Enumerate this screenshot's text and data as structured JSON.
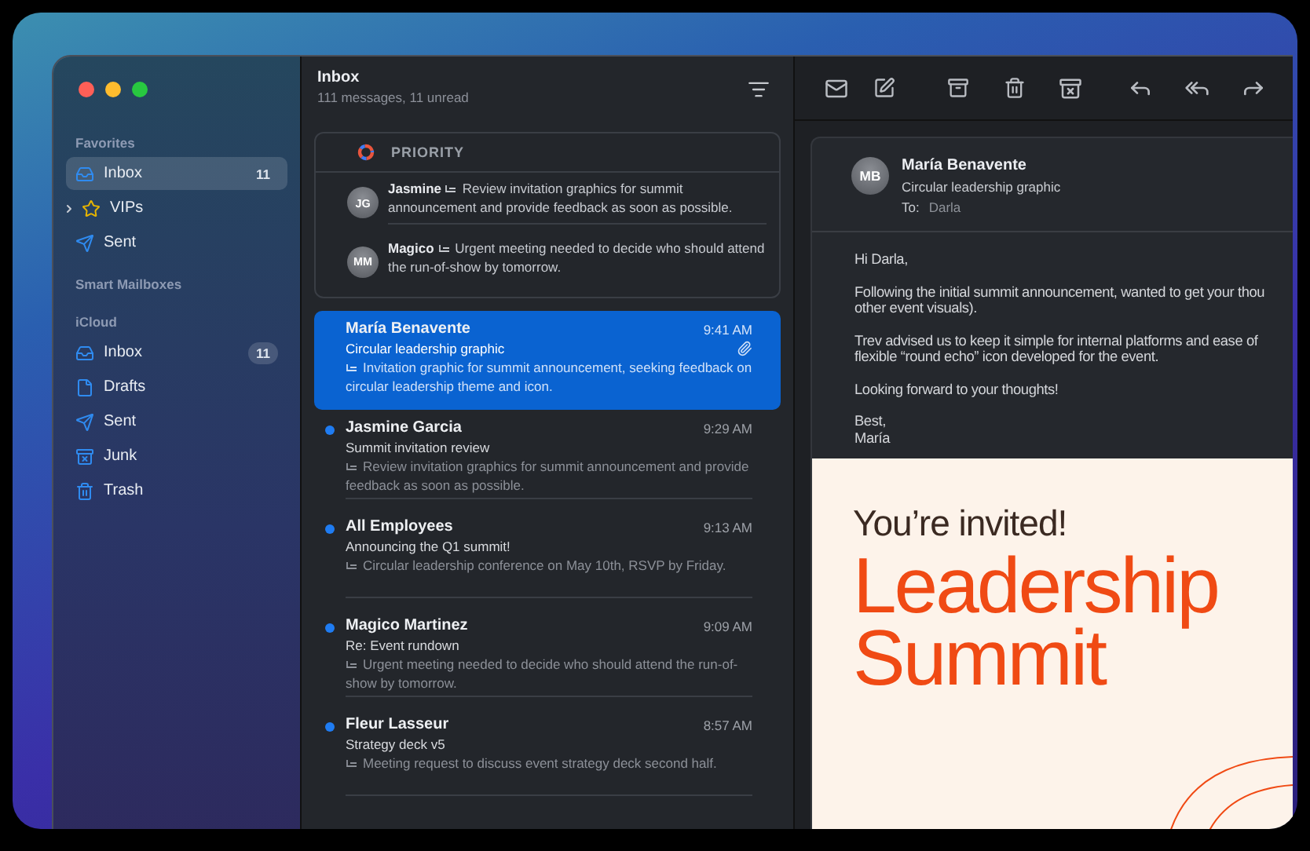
{
  "sidebar": {
    "sections": [
      {
        "title": "Favorites",
        "items": [
          {
            "label": "Inbox",
            "kind": "inbox",
            "count": "11",
            "selected": true,
            "expandable": false
          },
          {
            "label": "VIPs",
            "kind": "star",
            "selected": false,
            "expandable": true
          },
          {
            "label": "Sent",
            "kind": "sent",
            "selected": false,
            "expandable": false
          }
        ]
      },
      {
        "title": "Smart Mailboxes"
      },
      {
        "title": "iCloud",
        "items": [
          {
            "label": "Inbox",
            "kind": "inbox",
            "count": "11",
            "selected": false,
            "expandable": false
          },
          {
            "label": "Drafts",
            "kind": "drafts",
            "selected": false,
            "expandable": false
          },
          {
            "label": "Sent",
            "kind": "sent",
            "selected": false,
            "expandable": false
          },
          {
            "label": "Junk",
            "kind": "junk",
            "selected": false,
            "expandable": false
          },
          {
            "label": "Trash",
            "kind": "trash",
            "selected": false,
            "expandable": false
          }
        ]
      }
    ]
  },
  "message_list": {
    "title": "Inbox",
    "subtitle": "111 messages, 11 unread",
    "priority": {
      "label": "PRIORITY",
      "items": [
        {
          "initials": "JG",
          "sender": "Jasmine",
          "text": "Review invitation graphics for summit announcement and provide feedback as soon as possible."
        },
        {
          "initials": "MM",
          "sender": "Magico",
          "text": "Urgent meeting needed to decide who should attend the run-of-show by tomorrow."
        }
      ]
    },
    "messages": [
      {
        "sender": "María Benavente",
        "time": "9:41 AM",
        "subject": "Circular leadership graphic",
        "preview": "Invitation graphic for summit announcement, seeking feedback on circular leadership theme and icon.",
        "unread": false,
        "selected": true,
        "attachment": true
      },
      {
        "sender": "Jasmine Garcia",
        "time": "9:29 AM",
        "subject": "Summit invitation review",
        "preview": "Review invitation graphics for summit announcement and provide feedback as soon as possible.",
        "unread": true,
        "selected": false,
        "attachment": false
      },
      {
        "sender": "All Employees",
        "time": "9:13 AM",
        "subject": "Announcing the Q1 summit!",
        "preview": "Circular leadership conference on May 10th, RSVP by Friday.",
        "unread": true,
        "selected": false,
        "attachment": false
      },
      {
        "sender": "Magico Martinez",
        "time": "9:09 AM",
        "subject": "Re: Event rundown",
        "preview": "Urgent meeting needed to decide who should attend the run-of-show by tomorrow.",
        "unread": true,
        "selected": false,
        "attachment": false
      },
      {
        "sender": "Fleur Lasseur",
        "time": "8:57 AM",
        "subject": "Strategy deck v5",
        "preview": "Meeting request to discuss event strategy deck second half.",
        "unread": true,
        "selected": false,
        "attachment": false
      }
    ]
  },
  "reader": {
    "initials": "MB",
    "sender": "María Benavente",
    "subject": "Circular leadership graphic",
    "to_label": "To:",
    "to": "Darla",
    "paragraphs": [
      [
        "Hi Darla,"
      ],
      [
        "Following the initial summit announcement, wanted to get your thou",
        "other event visuals)."
      ],
      [
        "Trev advised us to keep it simple for internal platforms and ease of",
        "flexible “round echo” icon developed for the event."
      ],
      [
        "Looking forward to your thoughts!"
      ],
      [
        "Best,",
        "María"
      ]
    ],
    "poster": {
      "invite": "You’re invited!",
      "title_lines": [
        "Leadership",
        "Summit"
      ]
    }
  }
}
